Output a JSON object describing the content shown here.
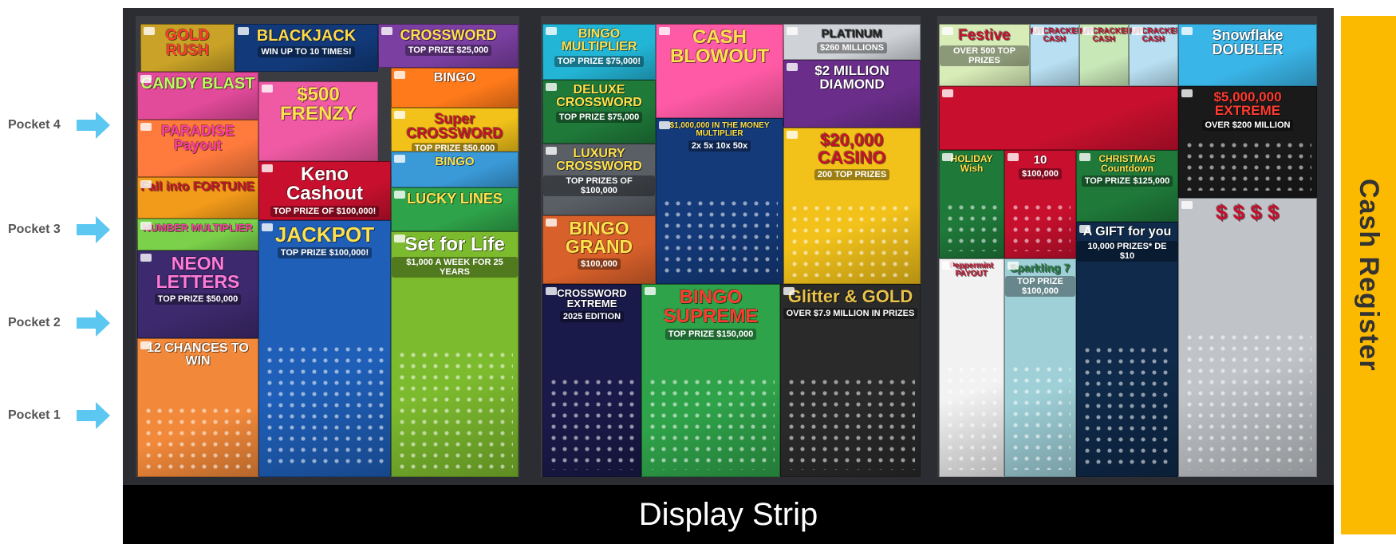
{
  "pockets": [
    {
      "label": "Pocket 4"
    },
    {
      "label": "Pocket 3"
    },
    {
      "label": "Pocket 2"
    },
    {
      "label": "Pocket 1"
    }
  ],
  "display_strip": {
    "label": "Display Strip"
  },
  "cash_register": {
    "label": "Cash Register"
  },
  "colors": {
    "arrow": "#5cc8f2",
    "register": "#fbb900",
    "strip": "#000000",
    "board": "#2b2d33"
  },
  "tickets": {
    "gold_rush": {
      "name": "GOLD RUSH",
      "prize": "",
      "color": "#c9a227",
      "text": "#ff3b2f"
    },
    "blackjack": {
      "name": "BLACKJACK",
      "prize": "WIN UP TO 10 TIMES!",
      "color": "#123a7a",
      "text": "#ffd84a"
    },
    "crossword": {
      "name": "CROSSWORD",
      "prize": "TOP PRIZE $25,000",
      "color": "#7a3fa0",
      "text": "#ffe14d"
    },
    "candy_blast": {
      "name": "CANDY BLAST",
      "prize": "",
      "color": "#e24a9a",
      "text": "#b6ff5a"
    },
    "frenzy": {
      "name": "$500 FRENZY",
      "prize": "",
      "color": "#f05aa5",
      "text": "#ffe14d"
    },
    "bingo_1": {
      "name": "BINGO",
      "prize": "",
      "color": "#ff7a1a",
      "text": "#fff"
    },
    "super_crossword": {
      "name": "Super CROSSWORD",
      "prize": "TOP PRIZE $50,000",
      "color": "#f2c21a",
      "text": "#c8102e"
    },
    "paradise": {
      "name": "PARADISE Payout",
      "prize": "",
      "color": "#ff7a3d",
      "text": "#ff3ea5"
    },
    "keno": {
      "name": "Keno Cashout",
      "prize": "TOP PRIZE OF $100,000!",
      "color": "#c8102e",
      "text": "#fff"
    },
    "bingo_2": {
      "name": "BINGO",
      "prize": "",
      "color": "#3a9ad8",
      "text": "#ffe14d"
    },
    "fall_fortune": {
      "name": "Fall into FORTUNE",
      "prize": "",
      "color": "#f29a1a",
      "text": "#c8102e"
    },
    "lucky_lines": {
      "name": "LUCKY LINES",
      "prize": "",
      "color": "#2fa34a",
      "text": "#ffe14d"
    },
    "number_multiplier": {
      "name": "NUMBER MULTIPLIER",
      "prize": "",
      "color": "#7bd14a",
      "text": "#ff3ea5"
    },
    "jackpot": {
      "name": "JACKPOT",
      "prize": "TOP PRIZE $100,000!",
      "color": "#1f5fb8",
      "text": "#ffe14d"
    },
    "set_for_life": {
      "name": "Set for Life",
      "prize": "$1,000 A WEEK FOR 25 YEARS",
      "color": "#7dbb2e",
      "text": "#fff"
    },
    "neon_letters": {
      "name": "NEON LETTERS",
      "prize": "TOP PRIZE $50,000",
      "color": "#3d2a6e",
      "text": "#ff7ad9"
    },
    "pocket1_ticket": {
      "name": "12 CHANCES TO WIN",
      "prize": "",
      "color": "#f2893a",
      "text": "#fff"
    },
    "bingo_multiplier": {
      "name": "BINGO MULTIPLIER",
      "prize": "TOP PRIZE $75,000!",
      "color": "#23b5d6",
      "text": "#ffe14d"
    },
    "cash_blowout": {
      "name": "CASH BLOWOUT",
      "prize": "",
      "color": "#ff5aa5",
      "text": "#ffe14d"
    },
    "platinum": {
      "name": "PLATINUM",
      "prize": "$260 MILLIONS",
      "color": "#cfd3d8",
      "text": "#222"
    },
    "deluxe_crossword": {
      "name": "DELUXE CROSSWORD",
      "prize": "TOP PRIZE $75,000",
      "color": "#1f7a3a",
      "text": "#ffe14d"
    },
    "diamond": {
      "name": "$2 MILLION DIAMOND",
      "prize": "",
      "color": "#6a2e8a",
      "text": "#fff"
    },
    "money_multiplier": {
      "name": "$1,000,000 IN THE MONEY MULTIPLIER",
      "prize": "2x 5x 10x 50x",
      "color": "#143a7a",
      "text": "#ffe14d"
    },
    "luxury_crossword": {
      "name": "LUXURY CROSSWORD",
      "prize": "TOP PRIZES OF $100,000",
      "color": "#5a5f66",
      "text": "#ffe14d"
    },
    "casino": {
      "name": "$20,000 CASINO",
      "prize": "200 TOP PRIZES",
      "color": "#f2c21a",
      "text": "#c8102e"
    },
    "bingo_grand": {
      "name": "BINGO GRAND",
      "prize": "$100,000",
      "color": "#d8602a",
      "text": "#ffe14d"
    },
    "crossword_extreme": {
      "name": "CROSSWORD EXTREME",
      "prize": "2025 EDITION",
      "color": "#1a1a4a",
      "text": "#fff"
    },
    "bingo_supreme": {
      "name": "BINGO SUPREME",
      "prize": "TOP PRIZE $150,000",
      "color": "#2fa34a",
      "text": "#ff3b2f"
    },
    "glitter_gold": {
      "name": "Glitter & GOLD",
      "prize": "OVER $7.9 MILLION IN PRIZES",
      "color": "#2a2a2a",
      "text": "#e8c24a"
    },
    "festive": {
      "name": "Festive",
      "prize": "OVER 500 TOP PRIZES",
      "color": "#d8ecb8",
      "text": "#c8102e"
    },
    "nutcracker_1": {
      "name": "NUTCRACKER CASH",
      "prize": "",
      "color": "#b8e0f2",
      "text": "#c8102e"
    },
    "nutcracker_2": {
      "name": "NUTCRACKER CASH",
      "prize": "",
      "color": "#c8e8b8",
      "text": "#c8102e"
    },
    "nutcracker_3": {
      "name": "NUTCRACKER CASH",
      "prize": "",
      "color": "#b8e0f2",
      "text": "#c8102e"
    },
    "snowflake_doubler": {
      "name": "Snowflake DOUBLER",
      "prize": "",
      "color": "#3ab5e8",
      "text": "#fff"
    },
    "holiday_pets": {
      "name": "",
      "prize": "",
      "color": "#c8102e",
      "text": "#fff"
    },
    "extreme": {
      "name": "$5,000,000 EXTREME",
      "prize": "OVER $200 MILLION",
      "color": "#1a1a1a",
      "text": "#ff3b2f"
    },
    "holiday_wish": {
      "name": "HOLIDAY Wish",
      "prize": "",
      "color": "#1f7a3a",
      "text": "#ffe14d"
    },
    "ten_x": {
      "name": "10",
      "prize": "$100,000",
      "color": "#c8102e",
      "text": "#fff"
    },
    "christmas_countdown": {
      "name": "CHRISTMAS Countdown",
      "prize": "TOP PRIZE $125,000",
      "color": "#1f7a3a",
      "text": "#ffe14d"
    },
    "peppermint": {
      "name": "Peppermint PAYOUT",
      "prize": "",
      "color": "#f2f2f2",
      "text": "#c8102e"
    },
    "sparkling_7": {
      "name": "Sparkling 7",
      "prize": "TOP PRIZE $100,000",
      "color": "#9fd0d8",
      "text": "#1f7a3a"
    },
    "gift_for_you": {
      "name": "A GIFT for you",
      "prize": "10,000 PRIZES* DE $10",
      "color": "#0f2a4a",
      "text": "#fff"
    },
    "money_bags": {
      "name": "$ $ $ $",
      "prize": "",
      "color": "#c0c4c8",
      "text": "#c8102e"
    }
  }
}
